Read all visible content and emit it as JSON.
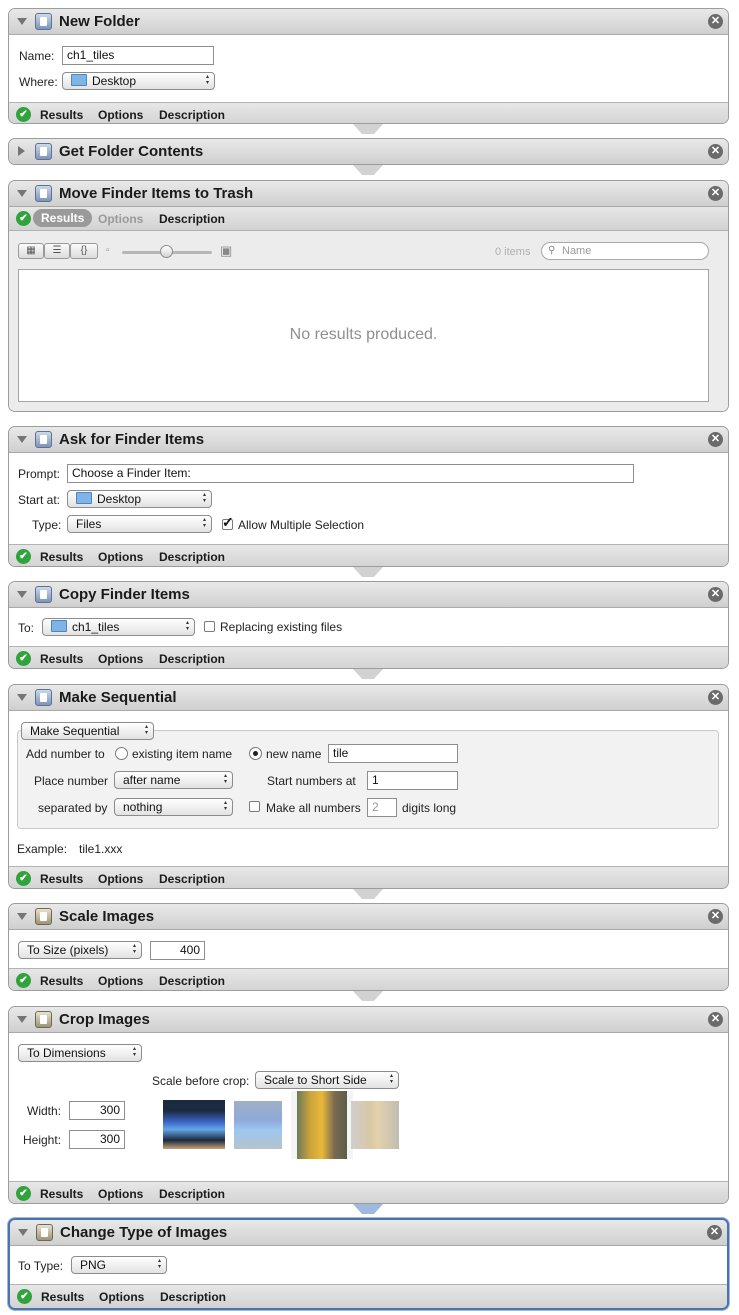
{
  "footer": {
    "results": "Results",
    "options": "Options",
    "description": "Description"
  },
  "actions": {
    "new_folder": {
      "title": "New Folder",
      "name_label": "Name:",
      "name_value": "ch1_tiles",
      "where_label": "Where:",
      "where_value": "Desktop"
    },
    "get_folder_contents": {
      "title": "Get Folder Contents"
    },
    "move_to_trash": {
      "title": "Move Finder Items to Trash",
      "items_count": "0 items",
      "search_placeholder": "Name",
      "no_results": "No results produced."
    },
    "ask_finder_items": {
      "title": "Ask for Finder Items",
      "prompt_label": "Prompt:",
      "prompt_value": "Choose a Finder Item:",
      "start_label": "Start at:",
      "start_value": "Desktop",
      "type_label": "Type:",
      "type_value": "Files",
      "multi_label": "Allow Multiple Selection",
      "multi_checked": true
    },
    "copy_finder_items": {
      "title": "Copy Finder Items",
      "to_label": "To:",
      "to_value": "ch1_tiles",
      "replace_label": "Replacing existing files",
      "replace_checked": false
    },
    "make_sequential": {
      "title": "Make Sequential",
      "mode_value": "Make Sequential",
      "add_number_label": "Add number to",
      "existing_label": "existing item name",
      "new_name_label": "new name",
      "new_name_value": "tile",
      "selected_option": "new name",
      "place_label": "Place number",
      "place_value": "after name",
      "start_label": "Start numbers at",
      "start_value": "1",
      "sep_label": "separated by",
      "sep_value": "nothing",
      "make_all_label": "Make all numbers",
      "make_all_checked": false,
      "digits_value": "2",
      "digits_label": "digits long",
      "example_label": "Example:",
      "example_value": "tile1.xxx"
    },
    "scale_images": {
      "title": "Scale Images",
      "mode_value": "To Size (pixels)",
      "size_value": "400"
    },
    "crop_images": {
      "title": "Crop Images",
      "mode_value": "To Dimensions",
      "scale_before_label": "Scale before crop:",
      "scale_before_value": "Scale to Short Side",
      "width_label": "Width:",
      "width_value": "300",
      "height_label": "Height:",
      "height_value": "300"
    },
    "change_type": {
      "title": "Change Type of Images",
      "to_type_label": "To Type:",
      "to_type_value": "PNG"
    }
  },
  "icons": {
    "checkmark": "✔",
    "close": "✕",
    "check": "✓"
  },
  "colors": {
    "success_green": "#2fa33c",
    "selection_blue": "#4a74b0",
    "folder_blue": "#7fb4e6"
  }
}
